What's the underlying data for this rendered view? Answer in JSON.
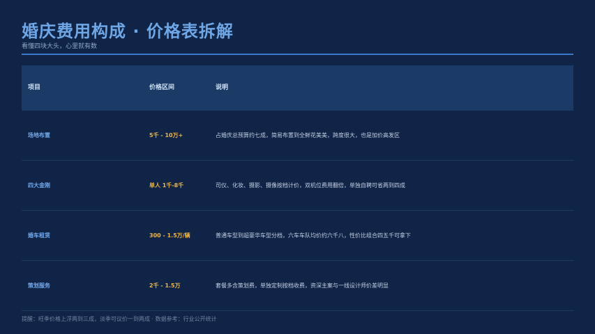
{
  "header": {
    "title": "婚庆费用构成 · 价格表拆解",
    "subtitle": "看懂四块大头，心里就有数"
  },
  "table": {
    "columns": [
      "项目",
      "价格区间",
      "说明"
    ],
    "rows": [
      {
        "item": "场地布置",
        "price": "5千 - 10万+",
        "desc": "占婚庆总预算约七成，简易布置到全鲜花美美，跨度很大，也是加价高发区"
      },
      {
        "item": "四大金刚",
        "price": "单人 1千-8千",
        "desc": "司仪、化妆、摄影、摄像按档计价，双机位费用翻倍，单独自聘可省两到四成"
      },
      {
        "item": "婚车租赁",
        "price": "300 - 1.5万/辆",
        "desc": "普通车型到超豪华车型分档，六车车队均价约六千八，性价比组合四五千可拿下"
      },
      {
        "item": "策划服务",
        "price": "2千 - 1.5万",
        "desc": "套餐多含策划费，单独定制按档收费，资深主案与一线设计师价差明显"
      }
    ]
  },
  "footer": {
    "note": "提醒：旺季价格上浮两到三成，淡季可议价一到两成 · 数据参考：行业公开统计"
  }
}
